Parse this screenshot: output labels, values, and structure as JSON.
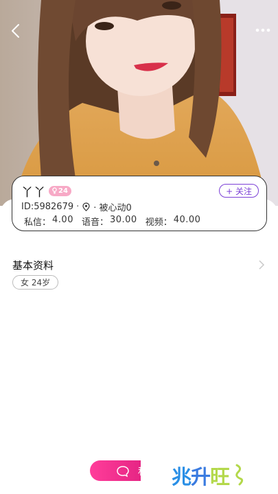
{
  "header": {
    "back_icon": "back-arrow-icon",
    "more_icon": "more-dots-icon"
  },
  "profile": {
    "nickname": "丫丫",
    "age_badge": "24",
    "gender_icon": "female-icon",
    "follow_label": "+ 关注",
    "id_text": "ID:5982679",
    "separator": "·",
    "location_icon": "location-pin-icon",
    "liked_text": "· 被心动0",
    "prices": [
      {
        "label": "私信：",
        "value": "4.00"
      },
      {
        "label": "语音：",
        "value": "30.00"
      },
      {
        "label": "视频：",
        "value": "40.00"
      }
    ]
  },
  "basic_info": {
    "title": "基本资料",
    "tag": "女 24岁"
  },
  "bottom": {
    "chat_icon": "chat-bubble-icon",
    "chat_label": "私"
  },
  "watermark": {
    "c1": "兆",
    "c2": "升",
    "c3": "旺"
  },
  "colors": {
    "accent": "#7b3fd6",
    "badge_pink": "#f7a9c6",
    "chat_gradient_start": "#ff3d9a",
    "chat_gradient_end": "#e0207f"
  }
}
